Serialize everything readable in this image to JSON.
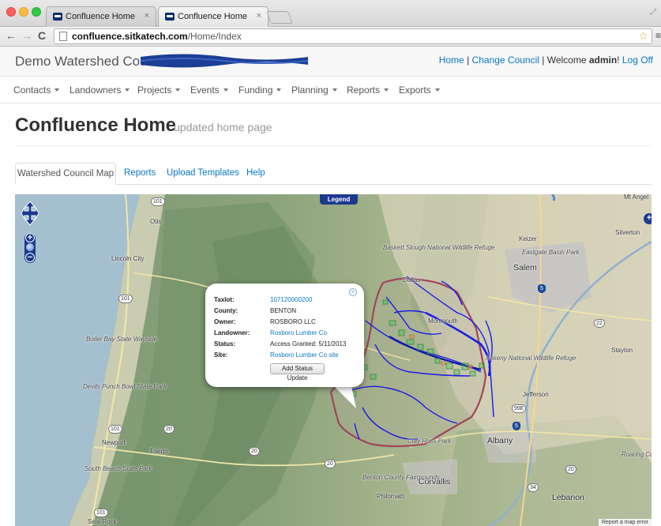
{
  "browser": {
    "tabs": [
      {
        "title": "Confluence Home",
        "close": "×"
      },
      {
        "title": "Confluence Home",
        "close": "×"
      }
    ],
    "url_host": "confluence.sitkatech.com",
    "url_path": "/Home/Index"
  },
  "header": {
    "brand": "Demo Watershed Council",
    "links": {
      "home": "Home",
      "sep1": " | ",
      "change_council": "Change Council",
      "sep2": " | Welcome ",
      "user": "admin",
      "bang": "! ",
      "log_off": "Log Off"
    }
  },
  "topnav": {
    "items": [
      "Contacts",
      "Landowners",
      "Projects",
      "Events",
      "Funding",
      "Planning",
      "Reports",
      "Exports"
    ]
  },
  "page": {
    "title": "Confluence Home",
    "subtitle": "updated home page"
  },
  "tabs": [
    "Watershed Council Map",
    "Reports",
    "Upload Templates",
    "Help"
  ],
  "map": {
    "legend": "Legend",
    "error_link": "Report a map error",
    "cities": {
      "otis": "Otis",
      "lincoln_city": "Lincoln City",
      "salem": "Salem",
      "keizer": "Keizer",
      "silverton": "Silverton",
      "mt_angel": "Mt Angel",
      "dallas": "Dallas",
      "monmouth": "Monmouth",
      "stayton": "Stayton",
      "jefferson": "Jefferson",
      "albany": "Albany",
      "corvallis": "Corvallis",
      "philomath": "Philomath",
      "lebanon": "Lebanon",
      "newport": "Newport",
      "toledo": "Toledo",
      "seal_rock": "Seal Rock"
    },
    "parks": {
      "eastgate": "Eastgate Basin Park",
      "baskett": "Baskett Slough National Wildlife Refuge",
      "ankeny": "Ankeny National Wildlife Refuge",
      "boiler_bay": "Boiler Bay State Wayside",
      "devils_punch": "Devils Punch Bowl State Park",
      "south_beach": "South Beach State Park",
      "benton_fair": "Benton County Fairgrounds",
      "clay_ross": "Clay Ross Park",
      "roaring": "Roaring Co Pa"
    },
    "shields": [
      "101",
      "101",
      "101",
      "101",
      "20",
      "20",
      "20",
      "22",
      "99E",
      "5",
      "5",
      "34",
      "20"
    ]
  },
  "popup": {
    "rows": [
      {
        "key": "Taxlot:",
        "value": "107120000200",
        "link": true
      },
      {
        "key": "County:",
        "value": "BENTON",
        "link": false
      },
      {
        "key": "Owner:",
        "value": "ROSBORO LLC",
        "link": false
      },
      {
        "key": "Landowner:",
        "value": "Rosboro Lumber Co",
        "link": true
      },
      {
        "key": "Status:",
        "value": "Access Granted: 5/11/2013",
        "link": false
      },
      {
        "key": "Site:",
        "value": "Rosboro Lumber Co site",
        "link": true
      }
    ],
    "button": "Add Status Update",
    "close": "×"
  },
  "colors": {
    "link": "#0a77c5",
    "map_control": "#1b3a8e",
    "watershed_boundary": "#a0455a",
    "streams": "#1a1ae6"
  }
}
